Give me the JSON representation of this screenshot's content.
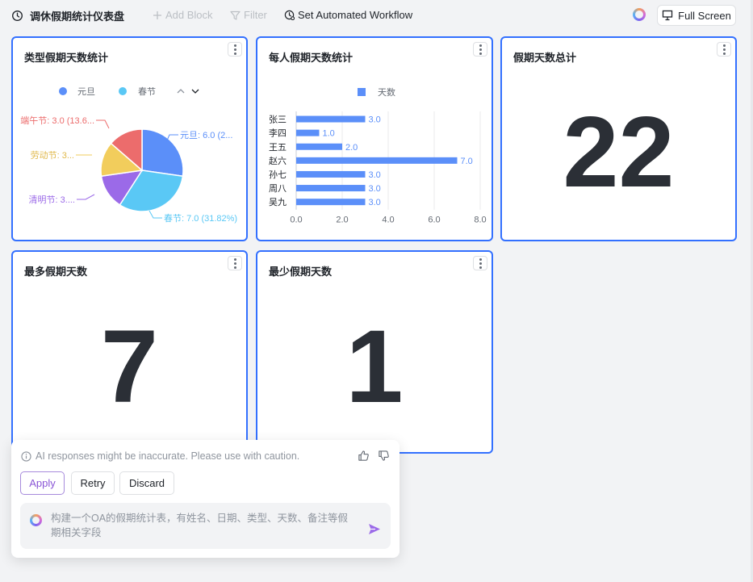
{
  "topbar": {
    "title": "调休假期统计仪表盘",
    "add_block": "Add Block",
    "filter": "Filter",
    "automation": "Set Automated Workflow",
    "full_screen": "Full Screen"
  },
  "cards": {
    "pie": {
      "title": "类型假期天数统计",
      "legend": [
        "元旦",
        "春节"
      ],
      "slice_labels": {
        "yuandan": "元旦: 6.0 (2...",
        "chunjie": "春节: 7.0 (31.82%)",
        "qingming": "清明节: 3....",
        "laodong": "劳动节: 3...",
        "duanwu": "端午节: 3.0 (13.6..."
      }
    },
    "bar": {
      "title": "每人假期天数统计",
      "legend": "天数"
    },
    "total": {
      "title": "假期天数总计",
      "value": "22"
    },
    "max": {
      "title": "最多假期天数",
      "value": "7"
    },
    "min": {
      "title": "最少假期天数",
      "value": "1"
    }
  },
  "chart_data": [
    {
      "type": "pie",
      "title": "类型假期天数统计",
      "slices": [
        {
          "name": "元旦",
          "value": 6.0,
          "color": "#5b8ff9"
        },
        {
          "name": "春节",
          "value": 7.0,
          "color": "#5ac8f5"
        },
        {
          "name": "清明节",
          "value": 3.0,
          "color": "#9b6ae8"
        },
        {
          "name": "劳动节",
          "value": 3.0,
          "color": "#f2cd5c"
        },
        {
          "name": "端午节",
          "value": 3.0,
          "color": "#ec6c6c"
        }
      ]
    },
    {
      "type": "bar",
      "title": "每人假期天数统计",
      "orientation": "horizontal",
      "categories": [
        "张三",
        "李四",
        "王五",
        "赵六",
        "孙七",
        "周八",
        "吴九"
      ],
      "series": [
        {
          "name": "天数",
          "values": [
            3.0,
            1.0,
            2.0,
            7.0,
            3.0,
            3.0,
            3.0
          ],
          "color": "#5b8ff9"
        }
      ],
      "xticks": [
        "0.0",
        "2.0",
        "4.0",
        "6.0",
        "8.0"
      ],
      "xlim": [
        0,
        8
      ],
      "grid": true,
      "legend": "top"
    }
  ],
  "ai": {
    "warning": "AI responses might be inaccurate. Please use with caution.",
    "apply": "Apply",
    "retry": "Retry",
    "discard": "Discard",
    "prompt": "构建一个OA的假期统计表，有姓名、日期、类型、天数、备注等假期相关字段"
  }
}
